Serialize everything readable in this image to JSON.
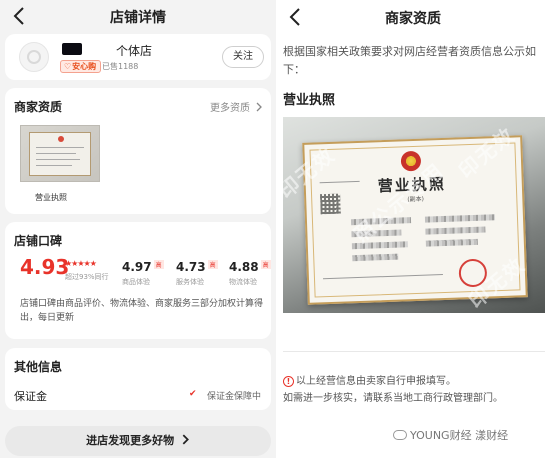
{
  "left": {
    "nav_title": "店铺详情",
    "store": {
      "type": "个体店",
      "badge": "安心购",
      "sold": "已售1188",
      "follow": "关注"
    },
    "qualification": {
      "title": "商家资质",
      "more": "更多资质",
      "thumb_label": "营业执照"
    },
    "reputation": {
      "title": "店铺口碑",
      "score": "4.93",
      "beyond": "超过93%同行",
      "metrics": [
        {
          "value": "4.97",
          "tag": "高",
          "label": "商品体验"
        },
        {
          "value": "4.73",
          "tag": "高",
          "label": "服务体验"
        },
        {
          "value": "4.88",
          "tag": "高",
          "label": "物流体验"
        }
      ],
      "desc": "店铺口碑由商品评价、物流体验、商家服务三部分加权计算得出，每日更新"
    },
    "other": {
      "title": "其他信息",
      "deposit_label": "保证金",
      "deposit_value": "保证金保障中"
    },
    "bottom_button": "进店发现更多好物"
  },
  "right": {
    "title": "商家资质",
    "intro": "根据国家相关政策要求对网店经营者资质信息公示如下：",
    "subtitle": "营业执照",
    "license_title": "营业执照",
    "license_copy": "(副本)",
    "watermark": "照公示专用",
    "watermark2": "印无效",
    "note1": "以上经营信息由卖家自行申报填写。",
    "note2": "如需进一步核实，请联系当地工商行政管理部门。",
    "brand": "YOUNG财经 漾财经"
  },
  "colors": {
    "accent_red": "#e8332a",
    "card_bg": "#ffffff",
    "page_bg": "#f3f3f3"
  }
}
